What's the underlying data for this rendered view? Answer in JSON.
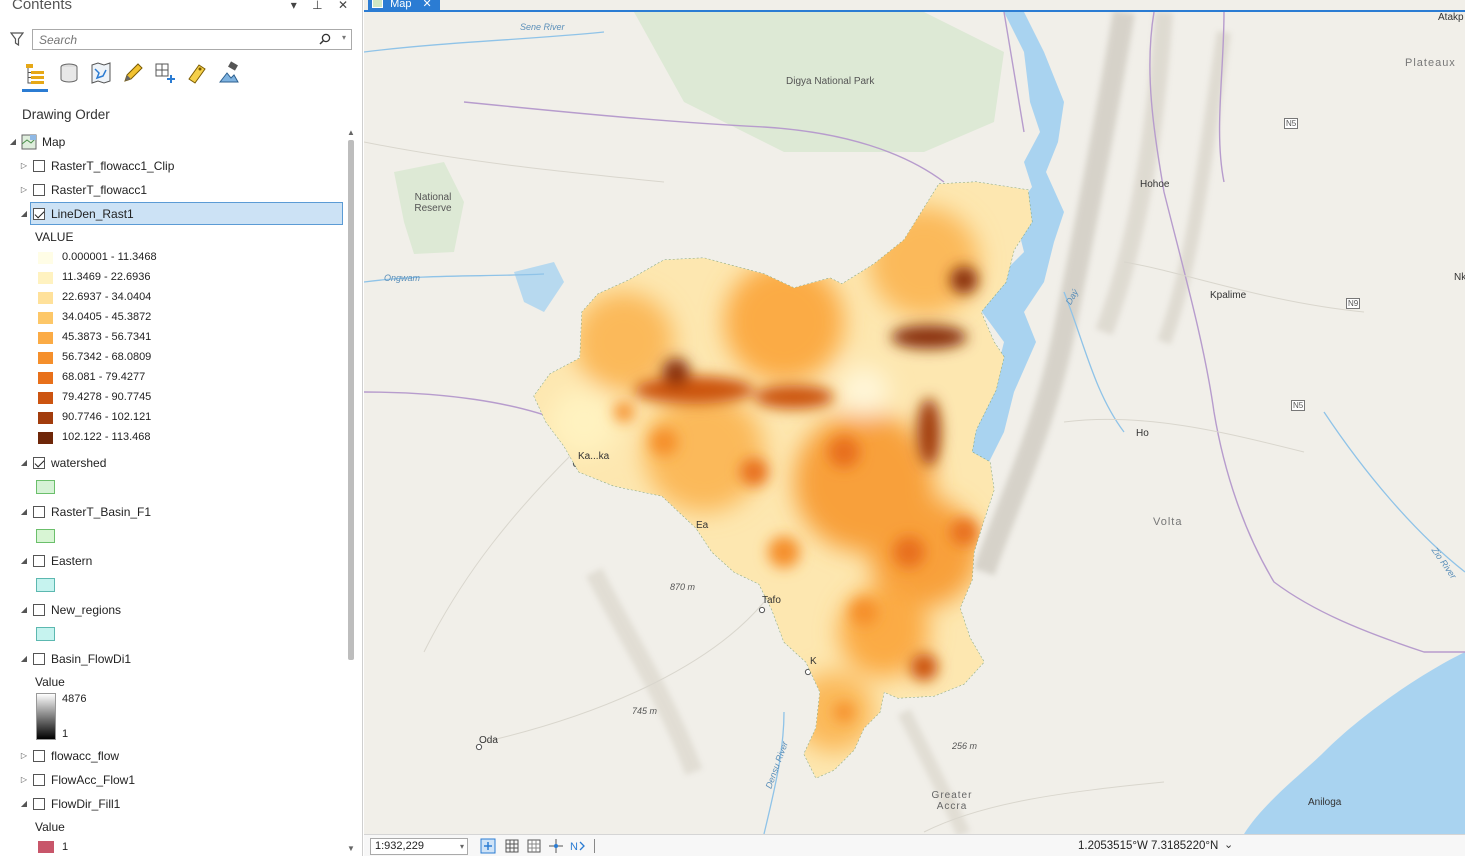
{
  "contents": {
    "title": "Contents",
    "pane_controls": "▾ ⊥ ✕",
    "search_placeholder": "Search",
    "section_title": "Drawing Order",
    "map_label": "Map",
    "layers": [
      {
        "name": "RasterT_flowacc1_Clip",
        "checked": false
      },
      {
        "name": "RasterT_flowacc1",
        "checked": false
      },
      {
        "name": "LineDen_Rast1",
        "checked": true
      },
      {
        "name": "watershed",
        "checked": true
      },
      {
        "name": "RasterT_Basin_F1",
        "checked": false
      },
      {
        "name": "Eastern",
        "checked": false
      },
      {
        "name": "New_regions",
        "checked": false
      },
      {
        "name": "Basin_FlowDi1",
        "checked": false
      },
      {
        "name": "flowacc_flow",
        "checked": false
      },
      {
        "name": "FlowAcc_Flow1",
        "checked": false
      },
      {
        "name": "FlowDir_Fill1",
        "checked": false
      }
    ],
    "lineden_legend": {
      "heading": "VALUE",
      "classes": [
        {
          "label": "0.000001 - 11.3468",
          "color": "#fffde6"
        },
        {
          "label": "11.3469 - 22.6936",
          "color": "#fff2c0"
        },
        {
          "label": "22.6937 - 34.0404",
          "color": "#ffe19a"
        },
        {
          "label": "34.0405 - 45.3872",
          "color": "#fdc768"
        },
        {
          "label": "45.3873 - 56.7341",
          "color": "#fbab45"
        },
        {
          "label": "56.7342 - 68.0809",
          "color": "#f58f2b"
        },
        {
          "label": "68.081 - 79.4277",
          "color": "#e8701a"
        },
        {
          "label": "79.4278 - 90.7745",
          "color": "#cc5410"
        },
        {
          "label": "90.7746 - 102.121",
          "color": "#a23c0c"
        },
        {
          "label": "102.122 - 113.468",
          "color": "#6e2608"
        }
      ]
    },
    "patch_colors": {
      "watershed": "#d6f2d6",
      "basin_f1": "#d8f5d4",
      "eastern": "#c6f3ef",
      "new_regions": "#c6f3ef"
    },
    "flowdi_legend": {
      "heading": "Value",
      "max": "4876",
      "min": "1"
    },
    "flowdir_legend": {
      "heading": "Value",
      "first_class": "1",
      "first_color": "#c8566a"
    }
  },
  "map": {
    "tab_label": "Map",
    "scale": "1:932,229",
    "coordinates": "1.2053515°W 7.3185220°N",
    "places": [
      "Digya National Park",
      "National Reserve",
      "Hohoe",
      "Kpalime",
      "Ho",
      "Volta",
      "Plateaux",
      "Atakp",
      "N5",
      "N9",
      "Sene River",
      "Ongwam",
      "Tafo",
      "Oda",
      "Greater Accra",
      "Aniloga",
      "870 m",
      "745 m",
      "256 m",
      "Densu River",
      "Daý",
      "Zio River",
      "Nk",
      "Ea",
      "Ka...ka",
      "K"
    ]
  }
}
